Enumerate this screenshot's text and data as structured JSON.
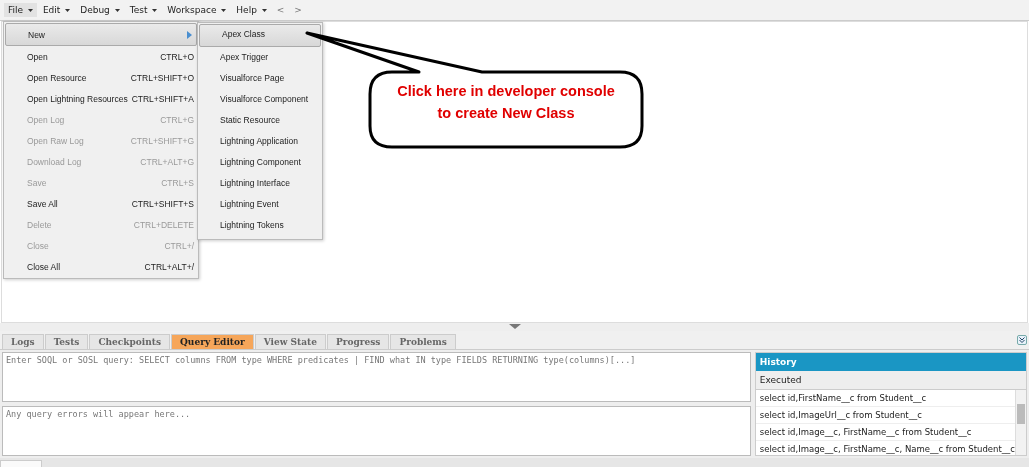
{
  "menubar": {
    "items": [
      {
        "label": "File",
        "selected": true
      },
      {
        "label": "Edit",
        "selected": false
      },
      {
        "label": "Debug",
        "selected": false
      },
      {
        "label": "Test",
        "selected": false
      },
      {
        "label": "Workspace",
        "selected": false
      },
      {
        "label": "Help",
        "selected": false
      }
    ],
    "nav": [
      "<",
      ">"
    ]
  },
  "file_menu": [
    {
      "label": "New",
      "kind": "submenu",
      "selected": true,
      "disabled": false
    },
    {
      "label": "Open",
      "shortcut": "CTRL+O",
      "kind": "item",
      "selected": false,
      "disabled": false
    },
    {
      "label": "Open Resource",
      "shortcut": "CTRL+SHIFT+O",
      "kind": "item",
      "selected": false,
      "disabled": false
    },
    {
      "label": "Open Lightning Resources",
      "shortcut": "CTRL+SHIFT+A",
      "kind": "item",
      "selected": false,
      "disabled": false
    },
    {
      "label": "Open Log",
      "shortcut": "CTRL+G",
      "kind": "item",
      "selected": false,
      "disabled": true
    },
    {
      "label": "Open Raw Log",
      "shortcut": "CTRL+SHIFT+G",
      "kind": "item",
      "selected": false,
      "disabled": true
    },
    {
      "label": "Download Log",
      "shortcut": "CTRL+ALT+G",
      "kind": "item",
      "selected": false,
      "disabled": true
    },
    {
      "label": "Save",
      "shortcut": "CTRL+S",
      "kind": "item",
      "selected": false,
      "disabled": true
    },
    {
      "label": "Save All",
      "shortcut": "CTRL+SHIFT+S",
      "kind": "item",
      "selected": false,
      "disabled": false
    },
    {
      "label": "Delete",
      "shortcut": "CTRL+DELETE",
      "kind": "item",
      "selected": false,
      "disabled": true
    },
    {
      "label": "Close",
      "shortcut": "CTRL+/",
      "kind": "item",
      "selected": false,
      "disabled": true
    },
    {
      "label": "Close All",
      "shortcut": "CTRL+ALT+/",
      "kind": "item",
      "selected": false,
      "disabled": false
    }
  ],
  "new_submenu": [
    {
      "label": "Apex Class",
      "selected": true
    },
    {
      "label": "Apex Trigger",
      "selected": false
    },
    {
      "label": "Visualforce Page",
      "selected": false
    },
    {
      "label": "Visualforce Component",
      "selected": false
    },
    {
      "label": "Static Resource",
      "selected": false
    },
    {
      "label": "Lightning Application",
      "selected": false
    },
    {
      "label": "Lightning Component",
      "selected": false
    },
    {
      "label": "Lightning Interface",
      "selected": false
    },
    {
      "label": "Lightning Event",
      "selected": false
    },
    {
      "label": "Lightning Tokens",
      "selected": false
    }
  ],
  "callout": {
    "text": "Click here in developer console to create New Class"
  },
  "bottom_tabs": [
    {
      "label": "Logs",
      "selected": false
    },
    {
      "label": "Tests",
      "selected": false
    },
    {
      "label": "Checkpoints",
      "selected": false
    },
    {
      "label": "Query Editor",
      "selected": true
    },
    {
      "label": "View State",
      "selected": false
    },
    {
      "label": "Progress",
      "selected": false
    },
    {
      "label": "Problems",
      "selected": false
    }
  ],
  "query_editor": {
    "placeholder": "Enter SOQL or SOSL query: SELECT columns FROM type WHERE predicates | FIND what IN type FIELDS RETURNING type(columns)[...]",
    "errors_placeholder": "Any query errors will appear here..."
  },
  "history": {
    "title": "History",
    "column": "Executed",
    "rows": [
      "select id,FirstName__c from Student__c",
      "select id,ImageUrl__c from Student__c",
      "select id,Image__c, FirstName__c from Student__c",
      "select id,Image__c, FirstName__c, Name__c from Student__c"
    ]
  }
}
